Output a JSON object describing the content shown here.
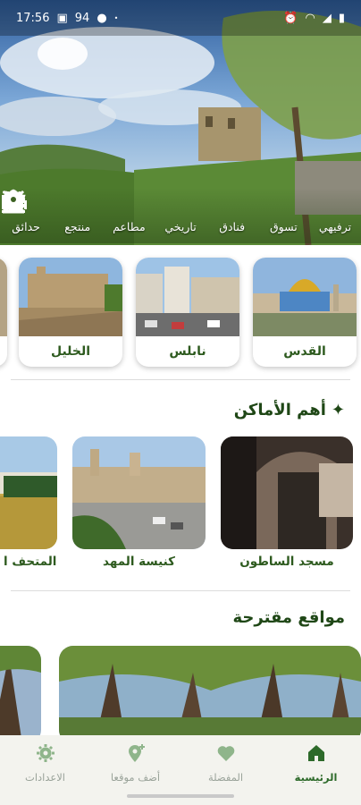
{
  "status_bar": {
    "time": "17:56",
    "battery": "94"
  },
  "categories": [
    {
      "label": "ترفيهي",
      "icon": "party-popper-icon"
    },
    {
      "label": "تسوق",
      "icon": "cart-icon"
    },
    {
      "label": "فنادق",
      "icon": "bed-icon"
    },
    {
      "label": "تاريخي",
      "icon": "museum-icon"
    },
    {
      "label": "مطاعم",
      "icon": "restaurant-icon"
    },
    {
      "label": "منتجع",
      "icon": "resort-icon"
    },
    {
      "label": "حدائق",
      "icon": "flower-icon"
    }
  ],
  "cities": [
    {
      "name": "القدس"
    },
    {
      "name": "نابلس"
    },
    {
      "name": "الخليل"
    }
  ],
  "top_places": {
    "title": "أهم الأماكن",
    "items": [
      {
        "name": "مسجد الساطون"
      },
      {
        "name": "كنيسة المهد"
      },
      {
        "name": "المتحف ا"
      }
    ]
  },
  "suggested": {
    "title": "مواقع مقترحة"
  },
  "bottom_nav": [
    {
      "label": "الرئيسية",
      "icon": "home-icon",
      "active": true
    },
    {
      "label": "المفضلة",
      "icon": "heart-icon",
      "active": false
    },
    {
      "label": "أضف موقعا",
      "icon": "add-location-icon",
      "active": false
    },
    {
      "label": "الاعدادات",
      "icon": "gear-icon",
      "active": false
    }
  ],
  "colors": {
    "accent": "#2d6a2a",
    "title": "#1f4716",
    "nav_bg": "#f3f3ee",
    "inactive": "#9aa39a"
  }
}
